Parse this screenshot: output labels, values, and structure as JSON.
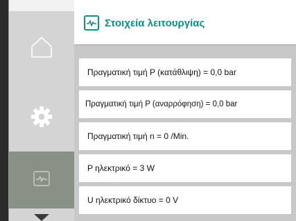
{
  "header": {
    "title": "Στοιχεία λειτουργίας",
    "icon": "pulse-diagnostics-icon",
    "accent_color": "#0f8f84"
  },
  "nav": {
    "items": [
      {
        "icon": "home-icon"
      },
      {
        "icon": "gear-icon"
      },
      {
        "icon": "pulse-diagnostics-icon",
        "selected": true
      }
    ]
  },
  "values": [
    {
      "label": "Πραγματική τιμή P (κατάθλιψη) = 0,0 bar"
    },
    {
      "label": "Πραγματική τιμή P (αναρρόφηση) = 0,0 bar"
    },
    {
      "label": "Πραγματική τιμή n = 0 /Min."
    },
    {
      "label": "P ηλεκτρικό = 3 W"
    },
    {
      "label": "U ηλεκτρικό δίκτυο = 0 V"
    }
  ]
}
